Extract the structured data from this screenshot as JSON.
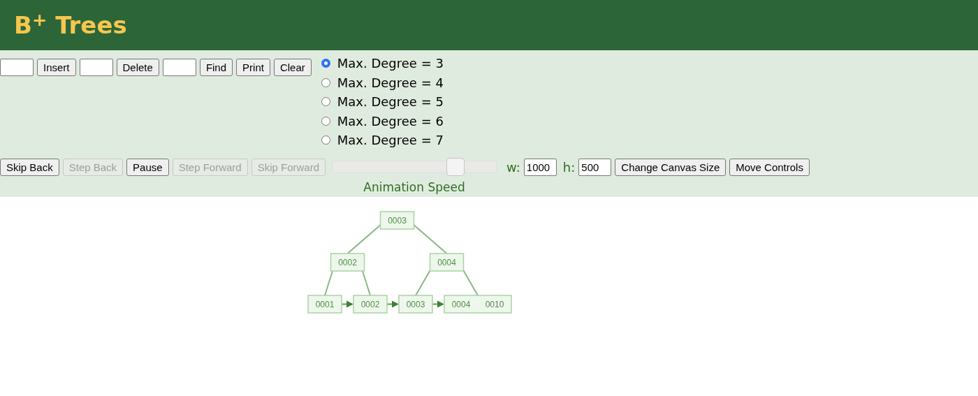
{
  "header": {
    "title": "B$^{+}$ Trees"
  },
  "top_controls": [
    {
      "kind": "field"
    },
    {
      "kind": "button",
      "label": "Insert",
      "disabled": false
    },
    {
      "kind": "field"
    },
    {
      "kind": "button",
      "label": "Delete",
      "disabled": false
    },
    {
      "kind": "field"
    },
    {
      "kind": "button",
      "label": "Find",
      "disabled": false
    },
    {
      "kind": "button",
      "label": "Print",
      "disabled": false
    },
    {
      "kind": "button",
      "label": "Clear",
      "disabled": false
    }
  ],
  "degree_options": [
    {
      "label": "Max. Degree = 3",
      "selected": true
    },
    {
      "label": "Max. Degree = 4",
      "selected": false
    },
    {
      "label": "Max. Degree = 5",
      "selected": false
    },
    {
      "label": "Max. Degree = 6",
      "selected": false
    },
    {
      "label": "Max. Degree = 7",
      "selected": false
    }
  ],
  "animation_buttons": [
    {
      "label": "Skip Back",
      "disabled": false
    },
    {
      "label": "Step Back",
      "disabled": true
    },
    {
      "label": "Pause",
      "disabled": false
    },
    {
      "label": "Step Forward",
      "disabled": true
    },
    {
      "label": "Skip Forward",
      "disabled": true
    }
  ],
  "speed_slider": {
    "level": 0.75,
    "label": "Animation Speed"
  },
  "canvas_size": {
    "width_label": "w:",
    "width_value": "1000",
    "height_label": "h:",
    "height_value": "500",
    "buttons": [
      "Change Canvas Size",
      "Move Controls"
    ]
  },
  "tree": {
    "keys": [
      "0003"
    ],
    "children": [
      {
        "keys": [
          "0002"
        ],
        "children": [
          {
            "keys": [
              "0001"
            ]
          },
          {
            "keys": [
              "0002"
            ]
          }
        ]
      },
      {
        "keys": [
          "0004"
        ],
        "children": [
          {
            "keys": [
              "0003"
            ]
          },
          {
            "keys": [
              "0004",
              "0010"
            ]
          }
        ]
      }
    ]
  }
}
